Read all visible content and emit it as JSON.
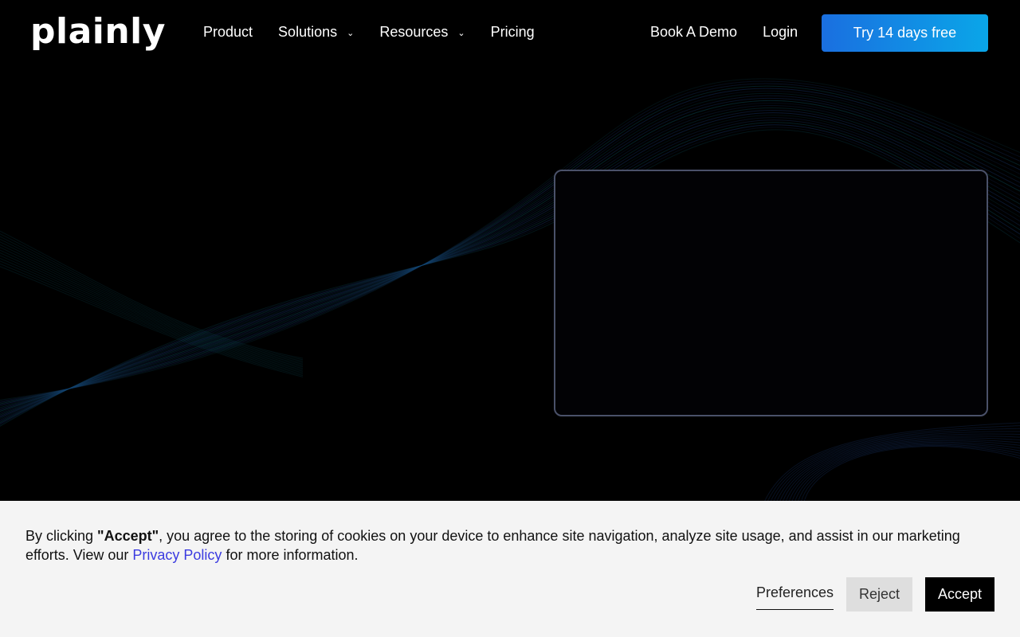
{
  "header": {
    "logo": "plainly",
    "nav": [
      {
        "label": "Product"
      },
      {
        "label": "Solutions",
        "chevron": "⌄"
      },
      {
        "label": "Resources",
        "chevron": "⌄"
      },
      {
        "label": "Pricing"
      }
    ],
    "book_demo": "Book A Demo",
    "login": "Login",
    "cta": "Try 14 days free"
  },
  "cookie_banner": {
    "text_before": "By clicking ",
    "text_bold": "\"Accept\"",
    "text_middle": ", you agree to the storing of cookies on your device to enhance site navigation, analyze site usage, and assist in our marketing efforts. View our ",
    "privacy_link": "Privacy Policy",
    "text_after": " for more information.",
    "preferences": "Preferences",
    "reject": "Reject",
    "accept": "Accept"
  },
  "colors": {
    "background": "#000000",
    "cta_gradient_start": "#1a6fe0",
    "cta_gradient_end": "#0aa6e8",
    "wave_blue": "#1b3d7a",
    "wave_teal": "#0e5a6a",
    "banner_bg": "#f4f4f4",
    "link": "#3b3be0"
  }
}
